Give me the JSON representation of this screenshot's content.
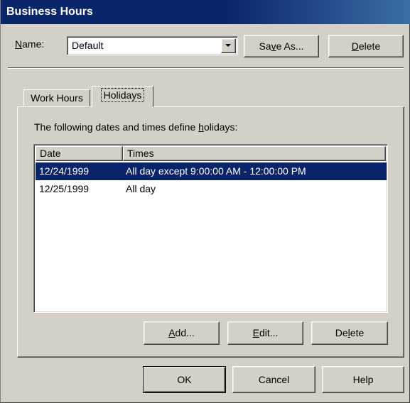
{
  "window": {
    "title": "Business Hours"
  },
  "name_field": {
    "label": "Name:",
    "label_accel": "N",
    "label_rest": "ame:",
    "value": "Default"
  },
  "buttons": {
    "save_as": {
      "pre": "Sa",
      "accel": "v",
      "post": "e As..."
    },
    "delete_top": {
      "pre": "",
      "accel": "D",
      "post": "elete"
    },
    "add": {
      "pre": "",
      "accel": "A",
      "post": "dd..."
    },
    "edit": {
      "pre": "",
      "accel": "E",
      "post": "dit..."
    },
    "delete_list": {
      "pre": "De",
      "accel": "l",
      "post": "ete"
    },
    "ok": "OK",
    "cancel": "Cancel",
    "help": "Help"
  },
  "tabs": [
    {
      "label": "Work Hours",
      "active": false
    },
    {
      "label": "Holidays",
      "active": true
    }
  ],
  "holidays": {
    "description_pre": "The following dates and times define ",
    "description_accel": "h",
    "description_post": "olidays:",
    "columns": [
      "Date",
      "Times"
    ],
    "rows": [
      {
        "date": "12/24/1999",
        "times": "All day except 9:00:00 AM - 12:00:00 PM",
        "selected": true
      },
      {
        "date": "12/25/1999",
        "times": "All day",
        "selected": false
      }
    ]
  },
  "colors": {
    "title_bar": "#0a246a",
    "selection": "#0a246a",
    "face": "#d4d0c8"
  }
}
